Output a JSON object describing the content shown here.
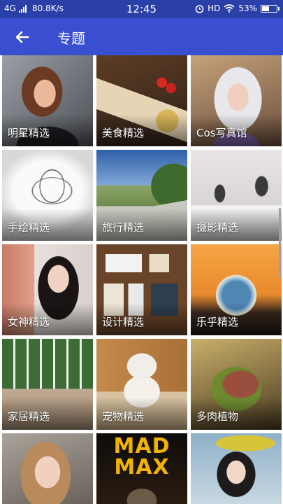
{
  "status_bar": {
    "network": "4G",
    "speed": "80.8K/s",
    "time": "12:45",
    "hd": "HD",
    "battery": "53%",
    "battery_level": 0.53,
    "icons": [
      "signal-icon",
      "alarm-icon",
      "wifi-icon",
      "battery-icon"
    ]
  },
  "app_bar": {
    "title": "专题",
    "back_icon": "arrow-left-icon",
    "color": "#3a4fcf"
  },
  "tiles": [
    {
      "label": "明星精选"
    },
    {
      "label": "美食精选"
    },
    {
      "label": "Cos写真馆"
    },
    {
      "label": "手绘精选"
    },
    {
      "label": "旅行精选"
    },
    {
      "label": "摄影精选"
    },
    {
      "label": "女神精选"
    },
    {
      "label": "设计精选"
    },
    {
      "label": "乐乎精选"
    },
    {
      "label": "家居精选"
    },
    {
      "label": "宠物精选"
    },
    {
      "label": "多肉植物"
    },
    {
      "label": ""
    },
    {
      "label": "MAD MAX"
    },
    {
      "label": ""
    }
  ]
}
